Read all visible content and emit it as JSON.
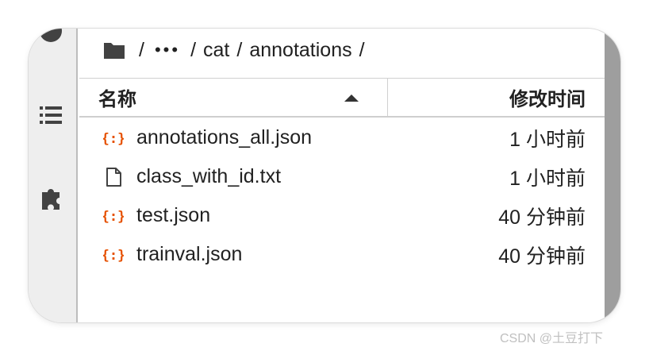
{
  "breadcrumb": {
    "icon": "folder-icon",
    "ellipsis": "•••",
    "segments": [
      "cat",
      "annotations"
    ],
    "separator": "/"
  },
  "sidebar": {
    "icons": [
      "circle-icon",
      "list-icon",
      "puzzle-icon"
    ]
  },
  "table": {
    "headers": {
      "name": "名称",
      "modified": "修改时间"
    },
    "sort": "name-ascending",
    "rows": [
      {
        "icon": "json-icon",
        "name": "annotations_all.json",
        "modified": "1 小时前"
      },
      {
        "icon": "file-icon",
        "name": "class_with_id.txt",
        "modified": "1 小时前"
      },
      {
        "icon": "json-icon",
        "name": "test.json",
        "modified": "40 分钟前"
      },
      {
        "icon": "json-icon",
        "name": "trainval.json",
        "modified": "40 分钟前"
      }
    ]
  },
  "colors": {
    "json_icon": "#e65100",
    "text": "#212121",
    "sidebar_bg": "#eeeeee"
  },
  "watermark": "CSDN @土豆打下"
}
